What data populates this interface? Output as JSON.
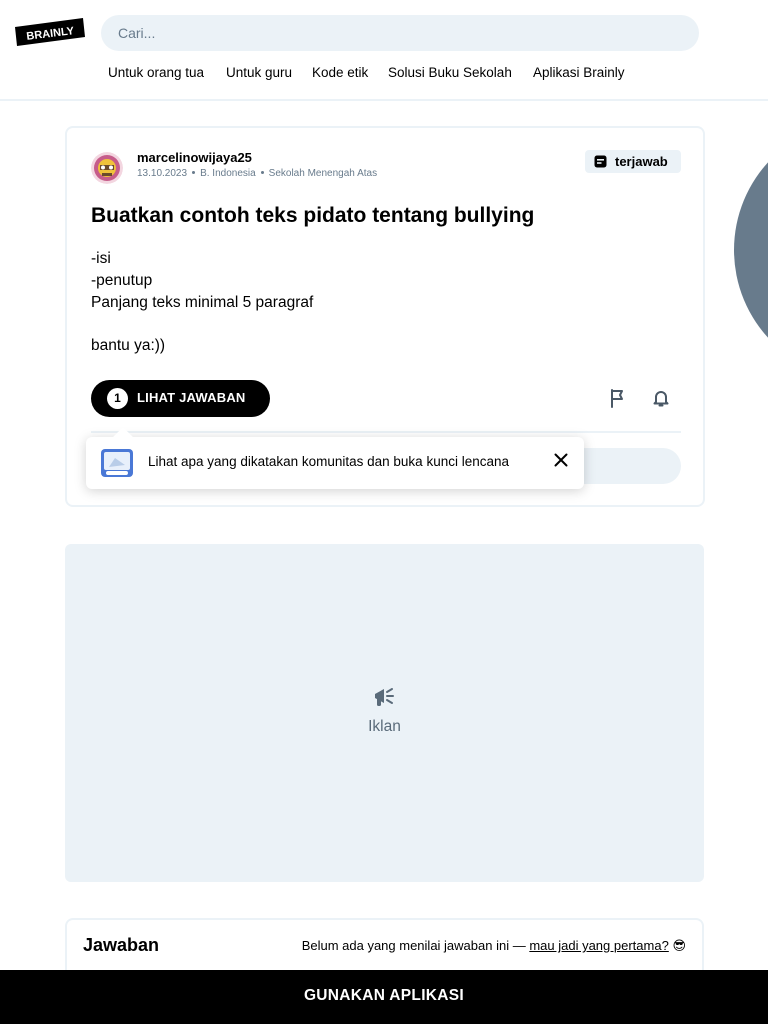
{
  "header": {
    "logo_text": "BRAINLY",
    "search": {
      "placeholder": "Cari..."
    },
    "nav": [
      {
        "label": "Untuk orang tua"
      },
      {
        "label": "Untuk guru"
      },
      {
        "label": "Kode etik"
      },
      {
        "label": "Solusi Buku Sekolah"
      },
      {
        "label": "Aplikasi Brainly"
      }
    ]
  },
  "question": {
    "author": "marcelinowijaya25",
    "date": "13.10.2023",
    "subject": "B. Indonesia",
    "level": "Sekolah Menengah Atas",
    "status_badge": "terjawab",
    "title": "Buatkan contoh teks pidato tentang bullying",
    "body_lines": [
      "-isi",
      "-penutup",
      "Panjang teks minimal 5 paragraf",
      "",
      "bantu ya:))"
    ],
    "answer_count": "1",
    "answer_button_label": "LIHAT JAWABAN"
  },
  "tooltip": {
    "text": "Lihat apa yang dikatakan komunitas dan buka kunci lencana"
  },
  "ad": {
    "label": "Iklan"
  },
  "answers_section": {
    "title": "Jawaban",
    "rating_text": "Belum ada yang menilai jawaban ini — ",
    "rating_link": "mau jadi yang pertama?",
    "rating_emoji": "😎"
  },
  "bottom_bar": {
    "label": "GUNAKAN APLIKASI"
  },
  "colors": {
    "accent_light": "#ebf2f7",
    "muted_text": "#687b8c",
    "black": "#000000"
  }
}
